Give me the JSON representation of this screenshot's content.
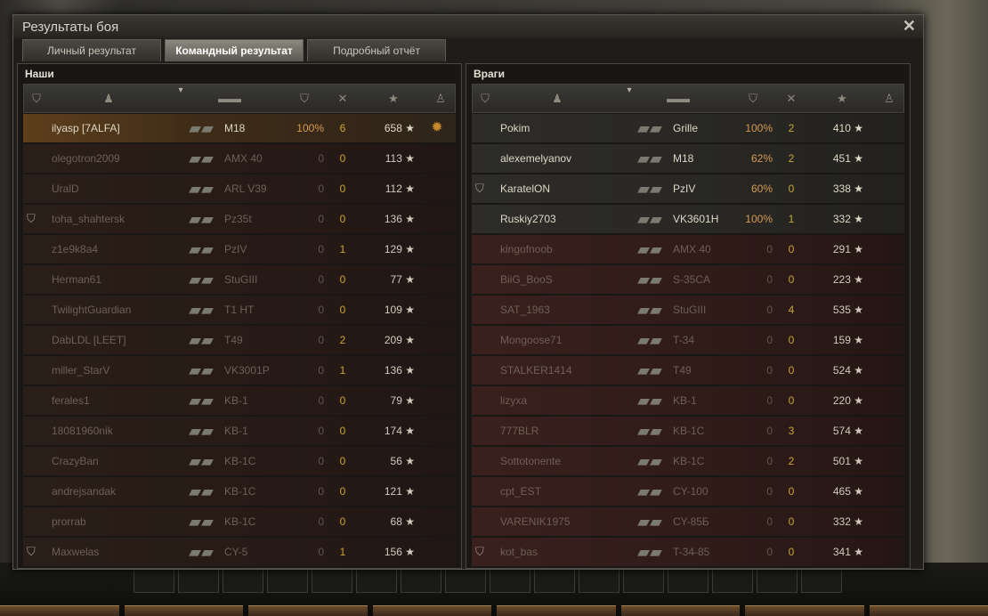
{
  "window": {
    "title": "Результаты боя",
    "close_icon": "close-icon"
  },
  "tabs": [
    {
      "label": "Личный результат",
      "active": false
    },
    {
      "label": "Командный результат",
      "active": true
    },
    {
      "label": "Подробный отчёт",
      "active": false
    }
  ],
  "columns": {
    "badge_icon": "shield-icon",
    "player_icon": "player-icon",
    "sort_icon": "chevron-down-icon",
    "tank_icon": "tank-icon",
    "damage_icon": "shield-icon",
    "kills_icon": "kills-icon",
    "xp_icon": "star-icon",
    "medal_icon": "medal-icon"
  },
  "teams": {
    "ours": {
      "label": "Наши",
      "rows": [
        {
          "name": "ilyasp [7ALFA]",
          "vehicle": "M18",
          "pct": "100%",
          "kills": "6",
          "xp": "658 ★",
          "state": "me",
          "badge": "",
          "medal": "✹"
        },
        {
          "name": "olegotron2009",
          "vehicle": "AMX 40",
          "pct": "0",
          "kills": "0",
          "xp": "113 ★",
          "state": "dead",
          "badge": "",
          "medal": ""
        },
        {
          "name": "UralD",
          "vehicle": "ARL V39",
          "pct": "0",
          "kills": "0",
          "xp": "112 ★",
          "state": "dead",
          "badge": "",
          "medal": ""
        },
        {
          "name": "toha_shahtersk",
          "vehicle": "Pz35t",
          "pct": "0",
          "kills": "0",
          "xp": "136 ★",
          "state": "dead",
          "badge": "⛉",
          "medal": ""
        },
        {
          "name": "z1e9k8a4",
          "vehicle": "PzIV",
          "pct": "0",
          "kills": "1",
          "xp": "129 ★",
          "state": "dead",
          "badge": "",
          "medal": ""
        },
        {
          "name": "Herman61",
          "vehicle": "StuGIII",
          "pct": "0",
          "kills": "0",
          "xp": "77 ★",
          "state": "dead",
          "badge": "",
          "medal": ""
        },
        {
          "name": "TwilightGuardian",
          "vehicle": "T1 HT",
          "pct": "0",
          "kills": "0",
          "xp": "109 ★",
          "state": "dead",
          "badge": "",
          "medal": ""
        },
        {
          "name": "DabLDL [LEET]",
          "vehicle": "T49",
          "pct": "0",
          "kills": "2",
          "xp": "209 ★",
          "state": "dead",
          "badge": "",
          "medal": ""
        },
        {
          "name": "miller_StarV",
          "vehicle": "VK3001P",
          "pct": "0",
          "kills": "1",
          "xp": "136 ★",
          "state": "dead",
          "badge": "",
          "medal": ""
        },
        {
          "name": "ferales1",
          "vehicle": "KB-1",
          "pct": "0",
          "kills": "0",
          "xp": "79 ★",
          "state": "dead",
          "badge": "",
          "medal": ""
        },
        {
          "name": "18081960nik",
          "vehicle": "KB-1",
          "pct": "0",
          "kills": "0",
          "xp": "174 ★",
          "state": "dead",
          "badge": "",
          "medal": ""
        },
        {
          "name": "CrazyBan",
          "vehicle": "KB-1C",
          "pct": "0",
          "kills": "0",
          "xp": "56 ★",
          "state": "dead",
          "badge": "",
          "medal": ""
        },
        {
          "name": "andrejsandak",
          "vehicle": "KB-1C",
          "pct": "0",
          "kills": "0",
          "xp": "121 ★",
          "state": "dead",
          "badge": "",
          "medal": ""
        },
        {
          "name": "prorrab",
          "vehicle": "KB-1C",
          "pct": "0",
          "kills": "0",
          "xp": "68 ★",
          "state": "dead",
          "badge": "",
          "medal": ""
        },
        {
          "name": "Maxwelas",
          "vehicle": "CY-5",
          "pct": "0",
          "kills": "1",
          "xp": "156 ★",
          "state": "dead",
          "badge": "⛉",
          "medal": ""
        }
      ]
    },
    "enemies": {
      "label": "Враги",
      "rows": [
        {
          "name": "Pokim",
          "vehicle": "Grille",
          "pct": "100%",
          "kills": "2",
          "xp": "410 ★",
          "state": "enemy-alive",
          "badge": "",
          "medal": ""
        },
        {
          "name": "alexemelyanov",
          "vehicle": "M18",
          "pct": "62%",
          "kills": "2",
          "xp": "451 ★",
          "state": "enemy-alive",
          "badge": "",
          "medal": ""
        },
        {
          "name": "KaratelON",
          "vehicle": "PzIV",
          "pct": "60%",
          "kills": "0",
          "xp": "338 ★",
          "state": "enemy-alive",
          "badge": "⛉",
          "medal": ""
        },
        {
          "name": "Ruskiy2703",
          "vehicle": "VK3601H",
          "pct": "100%",
          "kills": "1",
          "xp": "332 ★",
          "state": "enemy-alive",
          "badge": "",
          "medal": ""
        },
        {
          "name": "kingofnoob",
          "vehicle": "AMX 40",
          "pct": "0",
          "kills": "0",
          "xp": "291 ★",
          "state": "enemy-dead",
          "badge": "",
          "medal": ""
        },
        {
          "name": "BiiG_BooS",
          "vehicle": "S-35CA",
          "pct": "0",
          "kills": "0",
          "xp": "223 ★",
          "state": "enemy-dead",
          "badge": "",
          "medal": ""
        },
        {
          "name": "SAT_1963",
          "vehicle": "StuGIII",
          "pct": "0",
          "kills": "4",
          "xp": "535 ★",
          "state": "enemy-dead",
          "badge": "",
          "medal": ""
        },
        {
          "name": "Mongoose71",
          "vehicle": "T-34",
          "pct": "0",
          "kills": "0",
          "xp": "159 ★",
          "state": "enemy-dead",
          "badge": "",
          "medal": ""
        },
        {
          "name": "STALKER1414",
          "vehicle": "T49",
          "pct": "0",
          "kills": "0",
          "xp": "524 ★",
          "state": "enemy-dead",
          "badge": "",
          "medal": ""
        },
        {
          "name": "lizyxa",
          "vehicle": "KB-1",
          "pct": "0",
          "kills": "0",
          "xp": "220 ★",
          "state": "enemy-dead",
          "badge": "",
          "medal": ""
        },
        {
          "name": "777BLR",
          "vehicle": "KB-1C",
          "pct": "0",
          "kills": "3",
          "xp": "574 ★",
          "state": "enemy-dead",
          "badge": "",
          "medal": ""
        },
        {
          "name": "Sottotonente",
          "vehicle": "KB-1C",
          "pct": "0",
          "kills": "2",
          "xp": "501 ★",
          "state": "enemy-dead",
          "badge": "",
          "medal": ""
        },
        {
          "name": "cpt_EST",
          "vehicle": "CY-100",
          "pct": "0",
          "kills": "0",
          "xp": "465 ★",
          "state": "enemy-dead",
          "badge": "",
          "medal": ""
        },
        {
          "name": "VARENIK1975",
          "vehicle": "CY-85Б",
          "pct": "0",
          "kills": "0",
          "xp": "332 ★",
          "state": "enemy-dead",
          "badge": "",
          "medal": ""
        },
        {
          "name": "kot_bas",
          "vehicle": "T-34-85",
          "pct": "0",
          "kills": "0",
          "xp": "341 ★",
          "state": "enemy-dead",
          "badge": "⛉",
          "medal": ""
        }
      ]
    }
  }
}
